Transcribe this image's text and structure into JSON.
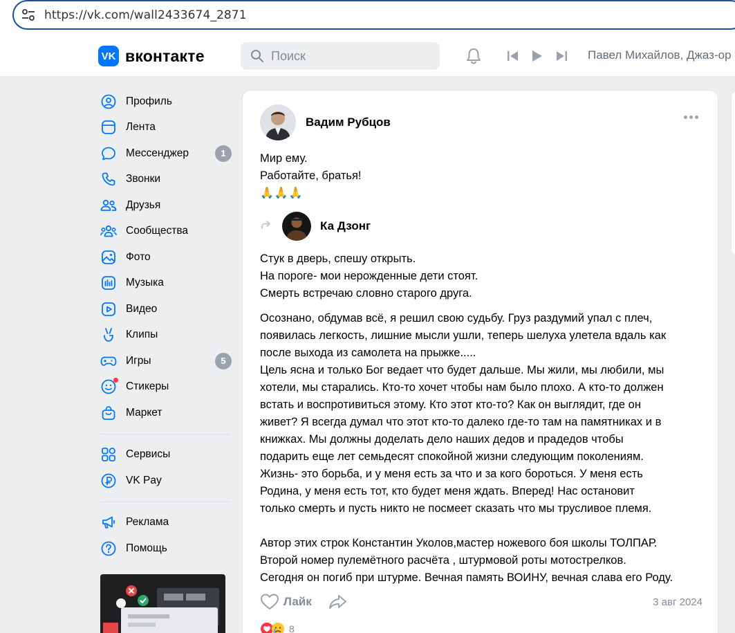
{
  "browser": {
    "url": "https://vk.com/wall2433674_2871"
  },
  "header": {
    "logo_mark": "VK",
    "logo_text": "вконтакте",
    "search_placeholder": "Поиск",
    "now_playing": "Павел Михайлов, Джаз-ор"
  },
  "sidebar": {
    "items": [
      {
        "label": "Профиль",
        "icon": "profile-icon"
      },
      {
        "label": "Лента",
        "icon": "feed-icon"
      },
      {
        "label": "Мессенджер",
        "icon": "messenger-icon",
        "badge": "1"
      },
      {
        "label": "Звонки",
        "icon": "phone-icon"
      },
      {
        "label": "Друзья",
        "icon": "friends-icon"
      },
      {
        "label": "Сообщества",
        "icon": "communities-icon"
      },
      {
        "label": "Фото",
        "icon": "photo-icon"
      },
      {
        "label": "Музыка",
        "icon": "music-icon"
      },
      {
        "label": "Видео",
        "icon": "video-icon"
      },
      {
        "label": "Клипы",
        "icon": "clips-icon"
      },
      {
        "label": "Игры",
        "icon": "games-icon",
        "badge": "5"
      },
      {
        "label": "Стикеры",
        "icon": "stickers-icon"
      },
      {
        "label": "Маркет",
        "icon": "market-icon"
      }
    ],
    "services": [
      {
        "label": "Сервисы",
        "icon": "services-icon"
      },
      {
        "label": "VK Pay",
        "icon": "vkpay-icon"
      }
    ],
    "footer": [
      {
        "label": "Реклама",
        "icon": "megaphone-icon"
      },
      {
        "label": "Помощь",
        "icon": "help-icon"
      }
    ]
  },
  "post": {
    "author": "Вадим Рубцов",
    "text_lines": [
      "Мир ему.",
      "Работайте, братья!"
    ],
    "emojis": "🙏🙏🙏",
    "repost_author": "Ка Дзонг",
    "poem_lines": [
      "Стук в дверь, спешу открыть.",
      "На пороге- мои нерожденные дети стоят.",
      "Смерть встречаю словно старого друга."
    ],
    "body_lines": [
      "Осознано, обдумав всё, я решил свою судьбу. Груз раздумий упал с плеч,",
      "появилась легкость, лишние мысли ушли, теперь шелуха улетела вдаль как",
      "после выхода из самолета на прыжке.....",
      "Цель ясна и только Бог ведает что будет дальше. Мы жили, мы любили, мы",
      "хотели, мы старались. Кто-то хочет чтобы нам было плохо. А кто-то должен",
      "встать и воспротивиться этому. Кто этот кто-то? Как он выглядит, где он",
      "живет? Я всегда думал что этот кто-то далеко где-то там на памятниках и в",
      "книжках. Мы должны доделать дело наших дедов и прадедов чтобы",
      "подарить еще лет семьдесят спокойной жизни следующим поколениям.",
      "Жизнь- это борьба, и у меня есть за что и за кого бороться. У меня есть",
      "Родина, у меня есть тот, кто будет меня ждать. Вперед! Нас остановит",
      "только смерть и пусть никто не посмеет сказать что мы трусливое племя.",
      "",
      "Автор этих строк Константин Уколов,мастер ножевого боя школы ТОЛПАР.",
      "Второй номер пулемётного расчёта , штурмовой роты мотострелков.",
      "Сегодня он погиб при штурме. Вечная память ВОИНУ, вечная слава его Роду."
    ],
    "like_label": "Лайк",
    "date": "3 авг 2024",
    "reactions_count": "8"
  },
  "colors": {
    "accent": "#0077ff",
    "badge": "#99a2ad",
    "muted": "#818c99",
    "bg": "#edeef0"
  }
}
